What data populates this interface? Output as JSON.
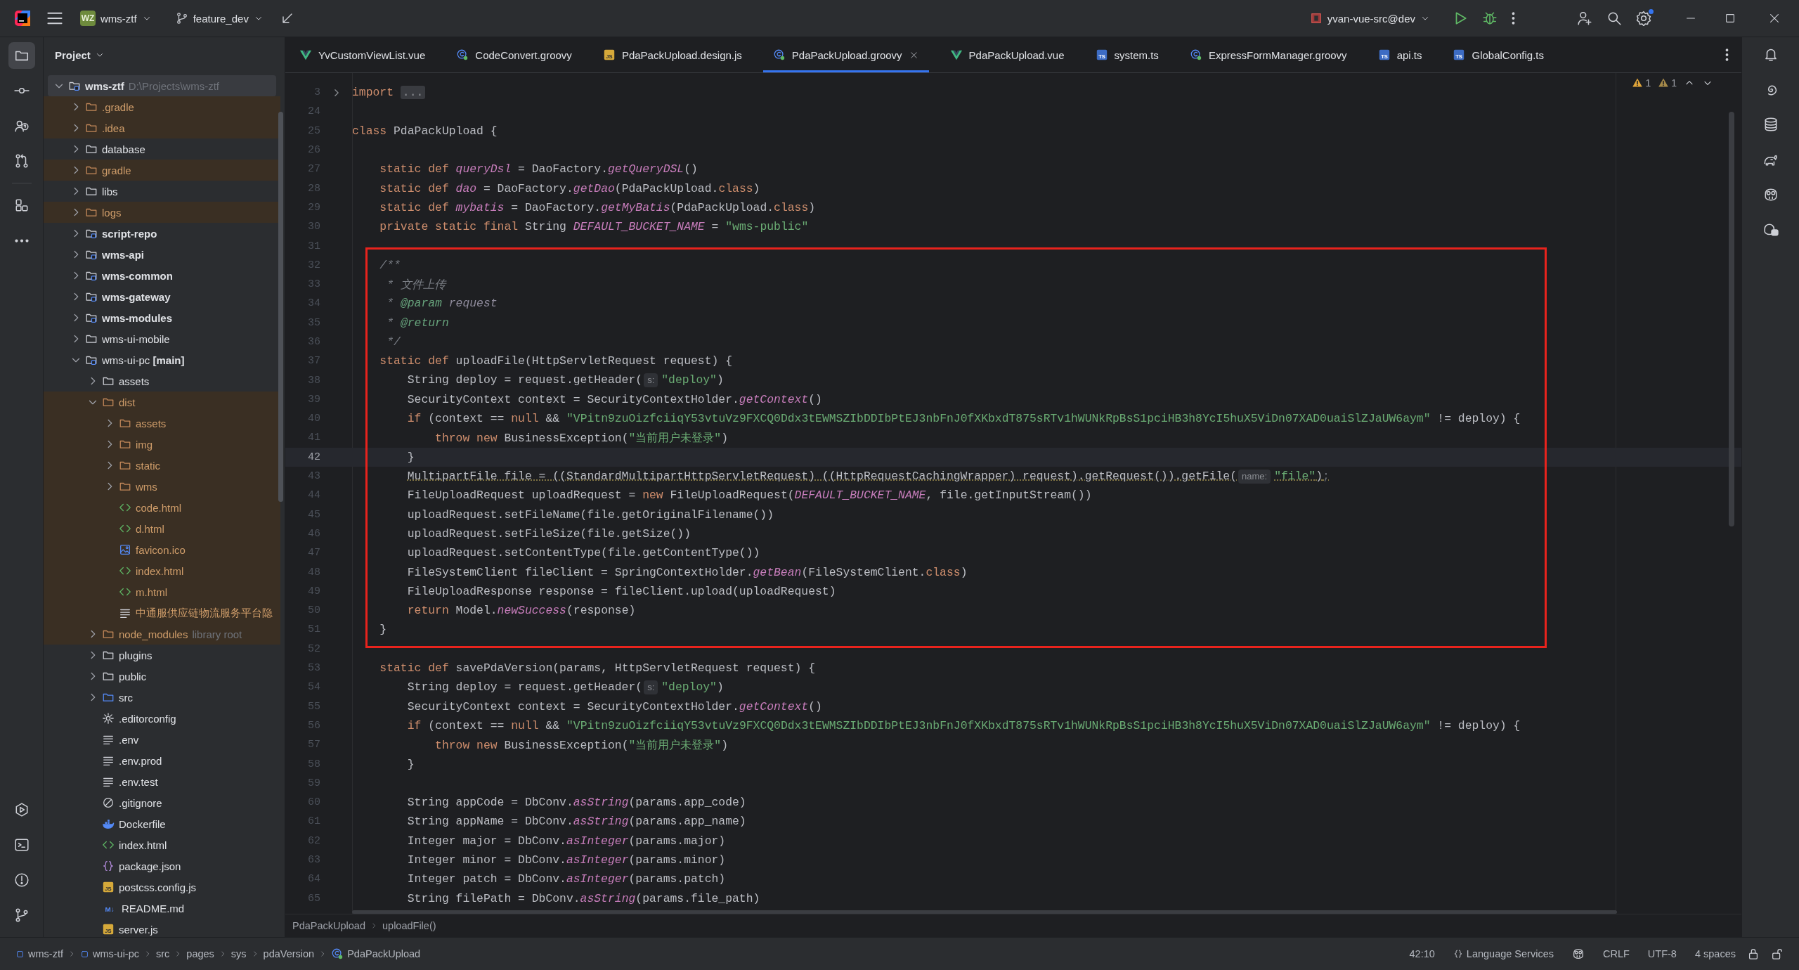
{
  "title_bar": {
    "project_badge": "WZ",
    "project": "wms-ztf",
    "branch": "feature_dev",
    "run_config": "yvan-vue-src@dev",
    "settings_badge": true
  },
  "left_toolbar": {
    "top": [
      {
        "kind": "project",
        "selected": true
      },
      {
        "kind": "commit",
        "selected": false
      },
      {
        "kind": "people",
        "selected": false
      },
      {
        "kind": "pull_requests",
        "selected": false
      },
      {
        "kind": "structure",
        "selected": false
      },
      {
        "kind": "more",
        "selected": false
      }
    ],
    "bottom": [
      {
        "kind": "run",
        "selected": false
      },
      {
        "kind": "terminal",
        "selected": false
      },
      {
        "kind": "problems",
        "selected": false
      },
      {
        "kind": "git",
        "selected": false
      }
    ]
  },
  "project_panel": {
    "title": "Project",
    "tree": [
      {
        "label": "wms-ztf",
        "kind": "module",
        "hint": "D:\\Projects\\wms-ztf",
        "expanded": true,
        "selected": true,
        "ignored": false,
        "children": [
          {
            "label": ".gradle",
            "kind": "folder",
            "expanded": false,
            "selected": false,
            "ignored": true
          },
          {
            "label": ".idea",
            "kind": "folder",
            "expanded": false,
            "selected": false,
            "ignored": true
          },
          {
            "label": "database",
            "kind": "folder",
            "expanded": false,
            "selected": false,
            "ignored": false
          },
          {
            "label": "gradle",
            "kind": "folder",
            "expanded": false,
            "selected": false,
            "ignored": true
          },
          {
            "label": "libs",
            "kind": "folder",
            "expanded": false,
            "selected": false,
            "ignored": false
          },
          {
            "label": "logs",
            "kind": "folder",
            "expanded": false,
            "selected": false,
            "ignored": true
          },
          {
            "label": "script-repo",
            "kind": "module",
            "expanded": false,
            "selected": false,
            "ignored": false
          },
          {
            "label": "wms-api",
            "kind": "module",
            "expanded": false,
            "selected": false,
            "ignored": false
          },
          {
            "label": "wms-common",
            "kind": "module",
            "expanded": false,
            "selected": false,
            "ignored": false
          },
          {
            "label": "wms-gateway",
            "kind": "module",
            "expanded": false,
            "selected": false,
            "ignored": false
          },
          {
            "label": "wms-modules",
            "kind": "module",
            "expanded": false,
            "selected": false,
            "ignored": false
          },
          {
            "label": "wms-ui-mobile",
            "kind": "folder",
            "expanded": false,
            "selected": false,
            "ignored": false
          },
          {
            "label": "wms-ui-pc **[main]**",
            "kind": "content_root",
            "expanded": true,
            "selected": false,
            "ignored": false,
            "children": [
              {
                "label": "assets",
                "kind": "folder",
                "expanded": false,
                "selected": false,
                "ignored": false
              },
              {
                "label": "dist",
                "kind": "folder",
                "expanded": true,
                "selected": false,
                "ignored": true,
                "children": [
                  {
                    "label": "assets",
                    "kind": "folder",
                    "expanded": false,
                    "selected": false,
                    "ignored": true
                  },
                  {
                    "label": "img",
                    "kind": "folder",
                    "expanded": false,
                    "selected": false,
                    "ignored": true
                  },
                  {
                    "label": "static",
                    "kind": "folder",
                    "expanded": false,
                    "selected": false,
                    "ignored": true
                  },
                  {
                    "label": "wms",
                    "kind": "folder",
                    "expanded": false,
                    "selected": false,
                    "ignored": true
                  },
                  {
                    "label": "code.html",
                    "kind": "html",
                    "selected": false,
                    "ignored": true
                  },
                  {
                    "label": "d.html",
                    "kind": "html",
                    "selected": false,
                    "ignored": true
                  },
                  {
                    "label": "favicon.ico",
                    "kind": "image",
                    "selected": false,
                    "ignored": true
                  },
                  {
                    "label": "index.html",
                    "kind": "html",
                    "selected": false,
                    "ignored": true
                  },
                  {
                    "label": "m.html",
                    "kind": "html",
                    "selected": false,
                    "ignored": true
                  },
                  {
                    "label": "中通服供应链物流服务平台隐",
                    "kind": "text",
                    "selected": false,
                    "ignored": true
                  }
                ]
              },
              {
                "label": "node_modules",
                "kind": "folder",
                "hint": "library root",
                "expanded": false,
                "selected": false,
                "ignored": true
              },
              {
                "label": "plugins",
                "kind": "folder",
                "expanded": false,
                "selected": false,
                "ignored": false
              },
              {
                "label": "public",
                "kind": "folder",
                "expanded": false,
                "selected": false,
                "ignored": false
              },
              {
                "label": "src",
                "kind": "source_folder",
                "expanded": false,
                "selected": false,
                "ignored": false
              },
              {
                "label": ".editorconfig",
                "kind": "config",
                "selected": false,
                "ignored": false
              },
              {
                "label": ".env",
                "kind": "text",
                "selected": false,
                "ignored": false
              },
              {
                "label": ".env.prod",
                "kind": "text",
                "selected": false,
                "ignored": false
              },
              {
                "label": ".env.test",
                "kind": "text",
                "selected": false,
                "ignored": false
              },
              {
                "label": ".gitignore",
                "kind": "ignore",
                "selected": false,
                "ignored": false
              },
              {
                "label": "Dockerfile",
                "kind": "docker",
                "selected": false,
                "ignored": false
              },
              {
                "label": "index.html",
                "kind": "html",
                "selected": false,
                "ignored": false
              },
              {
                "label": "package.json",
                "kind": "json",
                "selected": false,
                "ignored": false
              },
              {
                "label": "postcss.config.js",
                "kind": "js",
                "icon_text": "JS",
                "selected": false,
                "ignored": false
              },
              {
                "label": "README.md",
                "kind": "markdown",
                "icon_text": "M↓",
                "selected": false,
                "ignored": false
              },
              {
                "label": "server.js",
                "kind": "js",
                "icon_text": "JS",
                "selected": false,
                "ignored": false
              }
            ]
          }
        ]
      }
    ]
  },
  "tabs": [
    {
      "label": "YvCustomViewList.vue",
      "kind": "vue",
      "selected": false
    },
    {
      "label": "CodeConvert.groovy",
      "kind": "groovy",
      "selected": false
    },
    {
      "label": "PdaPackUpload.design.js",
      "kind": "js",
      "icon_text": "JS",
      "selected": false
    },
    {
      "label": "PdaPackUpload.groovy",
      "kind": "groovy",
      "selected": true
    },
    {
      "label": "PdaPackUpload.vue",
      "kind": "vue",
      "selected": false
    },
    {
      "label": "system.ts",
      "kind": "ts",
      "icon_text": "TS",
      "selected": false
    },
    {
      "label": "ExpressFormManager.groovy",
      "kind": "groovy",
      "selected": false
    },
    {
      "label": "api.ts",
      "kind": "ts",
      "icon_text": "TS",
      "selected": false
    },
    {
      "label": "GlobalConfig.ts",
      "kind": "ts",
      "icon_text": "TS",
      "selected": false
    }
  ],
  "editor": {
    "problems": [
      {
        "kind": "warning",
        "count": "1"
      },
      {
        "kind": "weak_warning",
        "count": "1"
      }
    ],
    "blocks": [
      {
        "boxed": false,
        "lines": [
          {
            "number": "3",
            "current": false,
            "folded": true,
            "tokens": [
              {
                "kind": "keyword",
                "text": "import "
              },
              {
                "kind": "folded",
                "text": "..."
              }
            ]
          },
          {
            "number": "24",
            "current": false,
            "folded": false
          },
          {
            "number": "25",
            "current": false,
            "folded": false,
            "tokens": [
              {
                "kind": "keyword",
                "text": "class "
              },
              {
                "kind": "plain",
                "text": "PdaPackUpload {"
              }
            ]
          },
          {
            "number": "26",
            "current": false,
            "folded": false
          },
          {
            "number": "27",
            "current": false,
            "folded": false,
            "tokens": [
              {
                "kind": "keyword",
                "text": "    static def "
              },
              {
                "kind": "static",
                "text": "queryDsl"
              },
              {
                "kind": "plain",
                "text": " = DaoFactory."
              },
              {
                "kind": "static",
                "text": "getQueryDSL"
              },
              {
                "kind": "plain",
                "text": "()"
              }
            ]
          },
          {
            "number": "28",
            "current": false,
            "folded": false,
            "tokens": [
              {
                "kind": "keyword",
                "text": "    static def "
              },
              {
                "kind": "static",
                "text": "dao"
              },
              {
                "kind": "plain",
                "text": " = DaoFactory."
              },
              {
                "kind": "static",
                "text": "getDao"
              },
              {
                "kind": "plain",
                "text": "(PdaPackUpload."
              },
              {
                "kind": "keyword",
                "text": "class"
              },
              {
                "kind": "plain",
                "text": ")"
              }
            ]
          },
          {
            "number": "29",
            "current": false,
            "folded": false,
            "tokens": [
              {
                "kind": "keyword",
                "text": "    static def "
              },
              {
                "kind": "static",
                "text": "mybatis"
              },
              {
                "kind": "plain",
                "text": " = DaoFactory."
              },
              {
                "kind": "static",
                "text": "getMyBatis"
              },
              {
                "kind": "plain",
                "text": "(PdaPackUpload."
              },
              {
                "kind": "keyword",
                "text": "class"
              },
              {
                "kind": "plain",
                "text": ")"
              }
            ]
          },
          {
            "number": "30",
            "current": false,
            "folded": false,
            "tokens": [
              {
                "kind": "keyword",
                "text": "    private static final "
              },
              {
                "kind": "plain",
                "text": "String "
              },
              {
                "kind": "static",
                "text": "DEFAULT_BUCKET_NAME"
              },
              {
                "kind": "plain",
                "text": " = "
              },
              {
                "kind": "string",
                "text": "\"wms-public\""
              }
            ]
          },
          {
            "number": "31",
            "current": false,
            "folded": false
          }
        ]
      },
      {
        "boxed": true,
        "lines": [
          {
            "number": "32",
            "current": false,
            "folded": false,
            "tokens": [
              {
                "kind": "comment",
                "text": "    /**"
              }
            ]
          },
          {
            "number": "33",
            "current": false,
            "folded": false,
            "tokens": [
              {
                "kind": "comment",
                "text": "     * 文件上传"
              }
            ]
          },
          {
            "number": "34",
            "current": false,
            "folded": false,
            "tokens": [
              {
                "kind": "comment",
                "text": "     * "
              },
              {
                "kind": "doctag",
                "text": "@param"
              },
              {
                "kind": "docparam",
                "text": " request"
              }
            ]
          },
          {
            "number": "35",
            "current": false,
            "folded": false,
            "tokens": [
              {
                "kind": "comment",
                "text": "     * "
              },
              {
                "kind": "doctag",
                "text": "@return"
              }
            ]
          },
          {
            "number": "36",
            "current": false,
            "folded": false,
            "tokens": [
              {
                "kind": "comment",
                "text": "     */"
              }
            ]
          },
          {
            "number": "37",
            "current": false,
            "folded": false,
            "tokens": [
              {
                "kind": "keyword",
                "text": "    static def "
              },
              {
                "kind": "plain",
                "text": "uploadFile(HttpServletRequest request) {"
              }
            ]
          },
          {
            "number": "38",
            "current": false,
            "folded": false,
            "tokens": [
              {
                "kind": "plain",
                "text": "        String deploy = request.getHeader("
              },
              {
                "kind": "hint",
                "text": "s:"
              },
              {
                "kind": "string",
                "text": "\"deploy\""
              },
              {
                "kind": "plain",
                "text": ")"
              }
            ]
          },
          {
            "number": "39",
            "current": false,
            "folded": false,
            "tokens": [
              {
                "kind": "plain",
                "text": "        SecurityContext context = SecurityContextHolder."
              },
              {
                "kind": "static",
                "text": "getContext"
              },
              {
                "kind": "plain",
                "text": "()"
              }
            ]
          },
          {
            "number": "40",
            "current": false,
            "folded": false,
            "tokens": [
              {
                "kind": "keyword",
                "text": "        if "
              },
              {
                "kind": "plain",
                "text": "(context == "
              },
              {
                "kind": "keyword",
                "text": "null"
              },
              {
                "kind": "plain",
                "text": " && "
              },
              {
                "kind": "string",
                "text": "\"VPitn9zuOizfciiqY53vtuVz9FXCQ0Ddx3tEWMSZIbDDIbPtEJ3nbFnJ0fXKbxdT875sRTv1hWUNkRpBsS1pciHB3h8YcI5huX5ViDn07XAD0uaiSlZJaUW6aym\""
              },
              {
                "kind": "plain",
                "text": " != deploy) {"
              }
            ]
          },
          {
            "number": "41",
            "current": false,
            "folded": false,
            "tokens": [
              {
                "kind": "keyword",
                "text": "            throw new "
              },
              {
                "kind": "plain",
                "text": "BusinessException("
              },
              {
                "kind": "string",
                "text": "\"当前用户未登录\""
              },
              {
                "kind": "plain",
                "text": ")"
              }
            ]
          },
          {
            "number": "42",
            "current": true,
            "folded": false,
            "tokens": [
              {
                "kind": "plain",
                "text": "        }"
              }
            ]
          },
          {
            "number": "43",
            "current": false,
            "folded": false,
            "tokens": [
              {
                "kind": "warning",
                "text": "        MultipartFile file = ((StandardMultipartHttpServletRequest) ((HttpRequestCachingWrapper) request).getRequest()).getFile("
              },
              {
                "kind": "hint",
                "text": "name:"
              },
              {
                "kind": "warning_string",
                "text": "\"file\""
              },
              {
                "kind": "warning",
                "text": ")"
              },
              {
                "kind": "warning_punct",
                "text": ";"
              }
            ]
          },
          {
            "number": "44",
            "current": false,
            "folded": false,
            "tokens": [
              {
                "kind": "plain",
                "text": "        FileUploadRequest uploadRequest = "
              },
              {
                "kind": "keyword",
                "text": "new "
              },
              {
                "kind": "plain",
                "text": "FileUploadRequest("
              },
              {
                "kind": "static",
                "text": "DEFAULT_BUCKET_NAME"
              },
              {
                "kind": "plain",
                "text": ", file.getInputStream())"
              }
            ]
          },
          {
            "number": "45",
            "current": false,
            "folded": false,
            "tokens": [
              {
                "kind": "plain",
                "text": "        uploadRequest.setFileName(file.getOriginalFilename())"
              }
            ]
          },
          {
            "number": "46",
            "current": false,
            "folded": false,
            "tokens": [
              {
                "kind": "plain",
                "text": "        uploadRequest.setFileSize(file.getSize())"
              }
            ]
          },
          {
            "number": "47",
            "current": false,
            "folded": false,
            "tokens": [
              {
                "kind": "plain",
                "text": "        uploadRequest.setContentType(file.getContentType())"
              }
            ]
          },
          {
            "number": "48",
            "current": false,
            "folded": false,
            "tokens": [
              {
                "kind": "plain",
                "text": "        FileSystemClient fileClient = SpringContextHolder."
              },
              {
                "kind": "static",
                "text": "getBean"
              },
              {
                "kind": "plain",
                "text": "(FileSystemClient."
              },
              {
                "kind": "keyword",
                "text": "class"
              },
              {
                "kind": "plain",
                "text": ")"
              }
            ]
          },
          {
            "number": "49",
            "current": false,
            "folded": false,
            "tokens": [
              {
                "kind": "plain",
                "text": "        FileUploadResponse response = fileClient.upload(uploadRequest)"
              }
            ]
          },
          {
            "number": "50",
            "current": false,
            "folded": false,
            "tokens": [
              {
                "kind": "keyword",
                "text": "        return "
              },
              {
                "kind": "plain",
                "text": "Model."
              },
              {
                "kind": "static",
                "text": "newSuccess"
              },
              {
                "kind": "plain",
                "text": "(response)"
              }
            ]
          },
          {
            "number": "51",
            "current": false,
            "folded": false,
            "tokens": [
              {
                "kind": "plain",
                "text": "    }"
              }
            ]
          }
        ]
      },
      {
        "boxed": false,
        "lines": [
          {
            "number": "52",
            "current": false,
            "folded": false
          },
          {
            "number": "53",
            "current": false,
            "folded": false,
            "tokens": [
              {
                "kind": "keyword",
                "text": "    static def "
              },
              {
                "kind": "plain",
                "text": "savePdaVersion(params, HttpServletRequest request) {"
              }
            ]
          },
          {
            "number": "54",
            "current": false,
            "folded": false,
            "tokens": [
              {
                "kind": "plain",
                "text": "        String deploy = request.getHeader("
              },
              {
                "kind": "hint",
                "text": "s:"
              },
              {
                "kind": "string",
                "text": "\"deploy\""
              },
              {
                "kind": "plain",
                "text": ")"
              }
            ]
          },
          {
            "number": "55",
            "current": false,
            "folded": false,
            "tokens": [
              {
                "kind": "plain",
                "text": "        SecurityContext context = SecurityContextHolder."
              },
              {
                "kind": "static",
                "text": "getContext"
              },
              {
                "kind": "plain",
                "text": "()"
              }
            ]
          },
          {
            "number": "56",
            "current": false,
            "folded": false,
            "tokens": [
              {
                "kind": "keyword",
                "text": "        if "
              },
              {
                "kind": "plain",
                "text": "(context == "
              },
              {
                "kind": "keyword",
                "text": "null"
              },
              {
                "kind": "plain",
                "text": " && "
              },
              {
                "kind": "string",
                "text": "\"VPitn9zuOizfciiqY53vtuVz9FXCQ0Ddx3tEWMSZIbDDIbPtEJ3nbFnJ0fXKbxdT875sRTv1hWUNkRpBsS1pciHB3h8YcI5huX5ViDn07XAD0uaiSlZJaUW6aym\""
              },
              {
                "kind": "plain",
                "text": " != deploy) {"
              }
            ]
          },
          {
            "number": "57",
            "current": false,
            "folded": false,
            "tokens": [
              {
                "kind": "keyword",
                "text": "            throw new "
              },
              {
                "kind": "plain",
                "text": "BusinessException("
              },
              {
                "kind": "string",
                "text": "\"当前用户未登录\""
              },
              {
                "kind": "plain",
                "text": ")"
              }
            ]
          },
          {
            "number": "58",
            "current": false,
            "folded": false,
            "tokens": [
              {
                "kind": "plain",
                "text": "        }"
              }
            ]
          },
          {
            "number": "59",
            "current": false,
            "folded": false
          },
          {
            "number": "60",
            "current": false,
            "folded": false,
            "tokens": [
              {
                "kind": "plain",
                "text": "        String appCode = DbConv."
              },
              {
                "kind": "static",
                "text": "asString"
              },
              {
                "kind": "plain",
                "text": "(params.app_code)"
              }
            ]
          },
          {
            "number": "61",
            "current": false,
            "folded": false,
            "tokens": [
              {
                "kind": "plain",
                "text": "        String appName = DbConv."
              },
              {
                "kind": "static",
                "text": "asString"
              },
              {
                "kind": "plain",
                "text": "(params.app_name)"
              }
            ]
          },
          {
            "number": "62",
            "current": false,
            "folded": false,
            "tokens": [
              {
                "kind": "plain",
                "text": "        Integer major = DbConv."
              },
              {
                "kind": "static",
                "text": "asInteger"
              },
              {
                "kind": "plain",
                "text": "(params.major)"
              }
            ]
          },
          {
            "number": "63",
            "current": false,
            "folded": false,
            "tokens": [
              {
                "kind": "plain",
                "text": "        Integer minor = DbConv."
              },
              {
                "kind": "static",
                "text": "asInteger"
              },
              {
                "kind": "plain",
                "text": "(params.minor)"
              }
            ]
          },
          {
            "number": "64",
            "current": false,
            "folded": false,
            "tokens": [
              {
                "kind": "plain",
                "text": "        Integer patch = DbConv."
              },
              {
                "kind": "static",
                "text": "asInteger"
              },
              {
                "kind": "plain",
                "text": "(params.patch)"
              }
            ]
          },
          {
            "number": "65",
            "current": false,
            "folded": false,
            "tokens": [
              {
                "kind": "plain",
                "text": "        String filePath = DbConv."
              },
              {
                "kind": "static",
                "text": "asString"
              },
              {
                "kind": "plain",
                "text": "(params.file_path)"
              }
            ]
          }
        ]
      }
    ],
    "breadcrumbs": [
      "PdaPackUpload",
      "uploadFile()"
    ]
  },
  "right_toolbar": [
    {
      "kind": "notifications"
    },
    {
      "kind": "ai_assistant"
    },
    {
      "kind": "database"
    },
    {
      "kind": "gradle"
    },
    {
      "kind": "copilot"
    },
    {
      "kind": "copilot_chat"
    }
  ],
  "status_bar": {
    "path": [
      {
        "label": "wms-ztf",
        "kind": "module"
      },
      {
        "label": "wms-ui-pc",
        "kind": "module"
      },
      {
        "label": "src",
        "kind": "plain"
      },
      {
        "label": "pages",
        "kind": "plain"
      },
      {
        "label": "sys",
        "kind": "plain"
      },
      {
        "label": "pdaVersion",
        "kind": "plain"
      },
      {
        "label": "PdaPackUpload",
        "kind": "groovy"
      }
    ],
    "position": "42:10",
    "language_services": "Language Services",
    "line_separator": "CRLF",
    "encoding": "UTF-8",
    "indent": "4 spaces"
  }
}
